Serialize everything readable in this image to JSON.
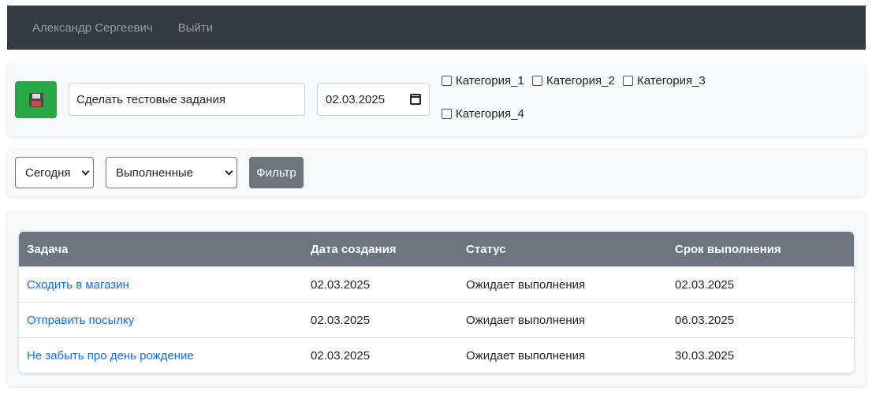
{
  "nav": {
    "user": "Александр Сергеевич",
    "logout": "Выйти"
  },
  "add_form": {
    "task_value": "Сделать тестовые задания",
    "date_value": "02.03.2025",
    "categories": [
      "Категория_1",
      "Категория_2",
      "Категория_3",
      "Категория_4"
    ]
  },
  "filter": {
    "period_selected": "Сегодня",
    "status_selected": "Выполненные",
    "button": "Фильтр"
  },
  "table": {
    "headers": [
      "Задача",
      "Дата создания",
      "Статус",
      "Срок выполнения"
    ],
    "rows": [
      {
        "task": "Сходить в магазин",
        "created": "02.03.2025",
        "status": "Ожидает выполнения",
        "due": "02.03.2025"
      },
      {
        "task": "Отправить посылку",
        "created": "02.03.2025",
        "status": "Ожидает выполнения",
        "due": "06.03.2025"
      },
      {
        "task": "Не забыть про день рождение",
        "created": "02.03.2025",
        "status": "Ожидает выполнения",
        "due": "30.03.2025"
      }
    ]
  },
  "colors": {
    "navbar": "#343a40",
    "save": "#28a745",
    "filter_button": "#6c757d",
    "link": "#0d6efd"
  },
  "icons": {
    "save": "floppy-disk-icon",
    "date": "calendar-icon",
    "select": "chevron-down-icon"
  }
}
